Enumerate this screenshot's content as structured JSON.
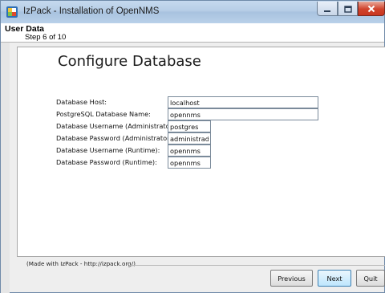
{
  "window": {
    "title": "IzPack - Installation of OpenNMS"
  },
  "header": {
    "title": "User Data",
    "step": "Step 6 of 10"
  },
  "panel": {
    "title": "Configure Database"
  },
  "form": {
    "fields": [
      {
        "label": "Database Host:",
        "value": "localhost"
      },
      {
        "label": "PostgreSQL Database Name:",
        "value": "opennms"
      },
      {
        "label": "Database Username (Administrator):",
        "value": "postgres"
      },
      {
        "label": "Database Password (Administrator):",
        "value": "administrador"
      },
      {
        "label": "Database Username (Runtime):",
        "value": "opennms"
      },
      {
        "label": "Database Password (Runtime):",
        "value": "opennms"
      }
    ]
  },
  "footer": {
    "credit": "(Made with IzPack - http://izpack.org/)"
  },
  "buttons": {
    "previous": "Previous",
    "next": "Next",
    "quit": "Quit"
  },
  "colors": {
    "titlebar": "#b6cde6",
    "close_button": "#d0432c",
    "default_button_border": "#3c7fb1"
  },
  "icons": [
    "izpack-app-icon",
    "minimize-icon",
    "maximize-icon",
    "close-icon"
  ]
}
